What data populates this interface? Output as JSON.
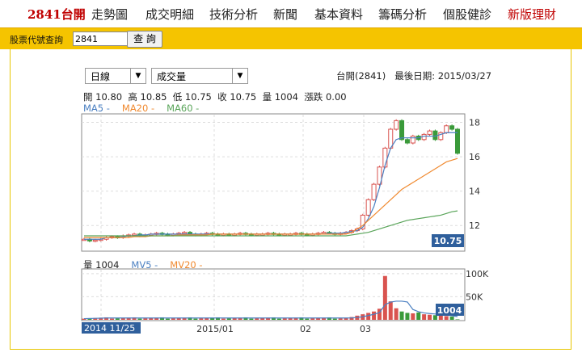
{
  "nav": {
    "brand": "2841台開",
    "items": [
      "走勢圖",
      "成交明細",
      "技術分析",
      "新聞",
      "基本資料",
      "籌碼分析",
      "個股健診",
      "新版理財"
    ]
  },
  "search": {
    "label": "股票代號查詢",
    "value": "2841",
    "button": "查 詢"
  },
  "selects": {
    "period": "日線",
    "indicator": "成交量"
  },
  "header": {
    "stock": "台開(2841)",
    "last_date": "最後日期: 2015/03/27"
  },
  "ohlc": {
    "open": "開 10.80",
    "high": "高 10.85",
    "low": "低 10.75",
    "close": "收 10.75",
    "volume": "量 1004",
    "change": "漲跌 0.00"
  },
  "ma_legend": {
    "ma5": "MA5 -",
    "ma20": "MA20 -",
    "ma60": "MA60 -"
  },
  "vol_legend": {
    "vol": "量 1004",
    "mv5": "MV5 -",
    "mv20": "MV20 -"
  },
  "colors": {
    "ma5": "#4a7fc1",
    "ma20": "#f08a30",
    "ma60": "#5aa55a",
    "up": "#d9534f",
    "down": "#3a9a3a",
    "tag": "#2f5f9c",
    "nav_bar": "#f5c400"
  },
  "chart_data": {
    "type": "candlestick",
    "price_axis": {
      "ticks": [
        12,
        14,
        16,
        18
      ],
      "ylim": [
        10.6,
        18.4
      ]
    },
    "volume_axis": {
      "ticks": [
        "50K",
        "100K"
      ],
      "ylim": [
        0,
        105000
      ]
    },
    "x_labels": [
      "2014 11/25",
      "2015/01",
      "02",
      "03"
    ],
    "last_price_tag": "10.75",
    "last_volume_tag": "1004",
    "candles_close": [
      11.2,
      11.1,
      11.15,
      11.2,
      11.3,
      11.35,
      11.3,
      11.4,
      11.45,
      11.5,
      11.4,
      11.45,
      11.5,
      11.55,
      11.5,
      11.45,
      11.5,
      11.55,
      11.6,
      11.5,
      11.45,
      11.5,
      11.55,
      11.5,
      11.45,
      11.5,
      11.45,
      11.5,
      11.55,
      11.5,
      11.45,
      11.5,
      11.5,
      11.55,
      11.5,
      11.45,
      11.5,
      11.5,
      11.55,
      11.5,
      11.45,
      11.5,
      11.55,
      11.6,
      11.55,
      11.5,
      11.55,
      11.6,
      11.7,
      11.8,
      12.6,
      13.5,
      14.4,
      15.4,
      16.5,
      17.6,
      18.1,
      17.0,
      16.8,
      17.2,
      17.0,
      17.3,
      17.5,
      17.0,
      17.4,
      17.8,
      17.6,
      16.2
    ],
    "ma5": [
      11.2,
      11.2,
      11.2,
      11.2,
      11.3,
      11.3,
      11.3,
      11.35,
      11.4,
      11.4,
      11.45,
      11.45,
      11.5,
      11.5,
      11.5,
      11.5,
      11.5,
      11.5,
      11.5,
      11.5,
      11.5,
      11.5,
      11.5,
      11.5,
      11.5,
      11.5,
      11.5,
      11.5,
      11.5,
      11.5,
      11.5,
      11.5,
      11.5,
      11.5,
      11.5,
      11.5,
      11.5,
      11.5,
      11.5,
      11.5,
      11.5,
      11.5,
      11.5,
      11.5,
      11.55,
      11.55,
      11.55,
      11.6,
      11.65,
      11.7,
      11.9,
      12.4,
      13.1,
      14.2,
      15.5,
      16.5,
      17.0,
      17.1,
      17.1,
      17.1,
      17.1,
      17.2,
      17.2,
      17.2,
      17.3,
      17.4,
      17.4,
      17.4
    ],
    "ma20": [
      11.3,
      11.3,
      11.3,
      11.3,
      11.3,
      11.3,
      11.3,
      11.3,
      11.3,
      11.35,
      11.35,
      11.35,
      11.4,
      11.4,
      11.4,
      11.4,
      11.4,
      11.45,
      11.45,
      11.45,
      11.45,
      11.45,
      11.45,
      11.5,
      11.5,
      11.5,
      11.5,
      11.5,
      11.5,
      11.5,
      11.5,
      11.5,
      11.5,
      11.5,
      11.5,
      11.5,
      11.5,
      11.5,
      11.5,
      11.5,
      11.5,
      11.5,
      11.5,
      11.5,
      11.5,
      11.5,
      11.5,
      11.5,
      11.6,
      11.8,
      12.0,
      12.3,
      12.6,
      12.9,
      13.2,
      13.5,
      13.8,
      14.1,
      14.3,
      14.5,
      14.7,
      14.9,
      15.1,
      15.3,
      15.5,
      15.7,
      15.8,
      15.9
    ],
    "ma60": [
      11.4,
      11.4,
      11.4,
      11.4,
      11.4,
      11.4,
      11.4,
      11.4,
      11.4,
      11.4,
      11.4,
      11.4,
      11.4,
      11.4,
      11.4,
      11.4,
      11.4,
      11.4,
      11.4,
      11.4,
      11.4,
      11.4,
      11.4,
      11.4,
      11.4,
      11.4,
      11.4,
      11.4,
      11.4,
      11.4,
      11.4,
      11.4,
      11.4,
      11.4,
      11.4,
      11.4,
      11.4,
      11.4,
      11.4,
      11.4,
      11.4,
      11.4,
      11.4,
      11.4,
      11.4,
      11.4,
      11.4,
      11.4,
      11.45,
      11.5,
      11.55,
      11.6,
      11.7,
      11.8,
      11.9,
      12.0,
      12.1,
      12.2,
      12.3,
      12.35,
      12.4,
      12.45,
      12.5,
      12.55,
      12.6,
      12.7,
      12.8,
      12.85
    ]
  }
}
